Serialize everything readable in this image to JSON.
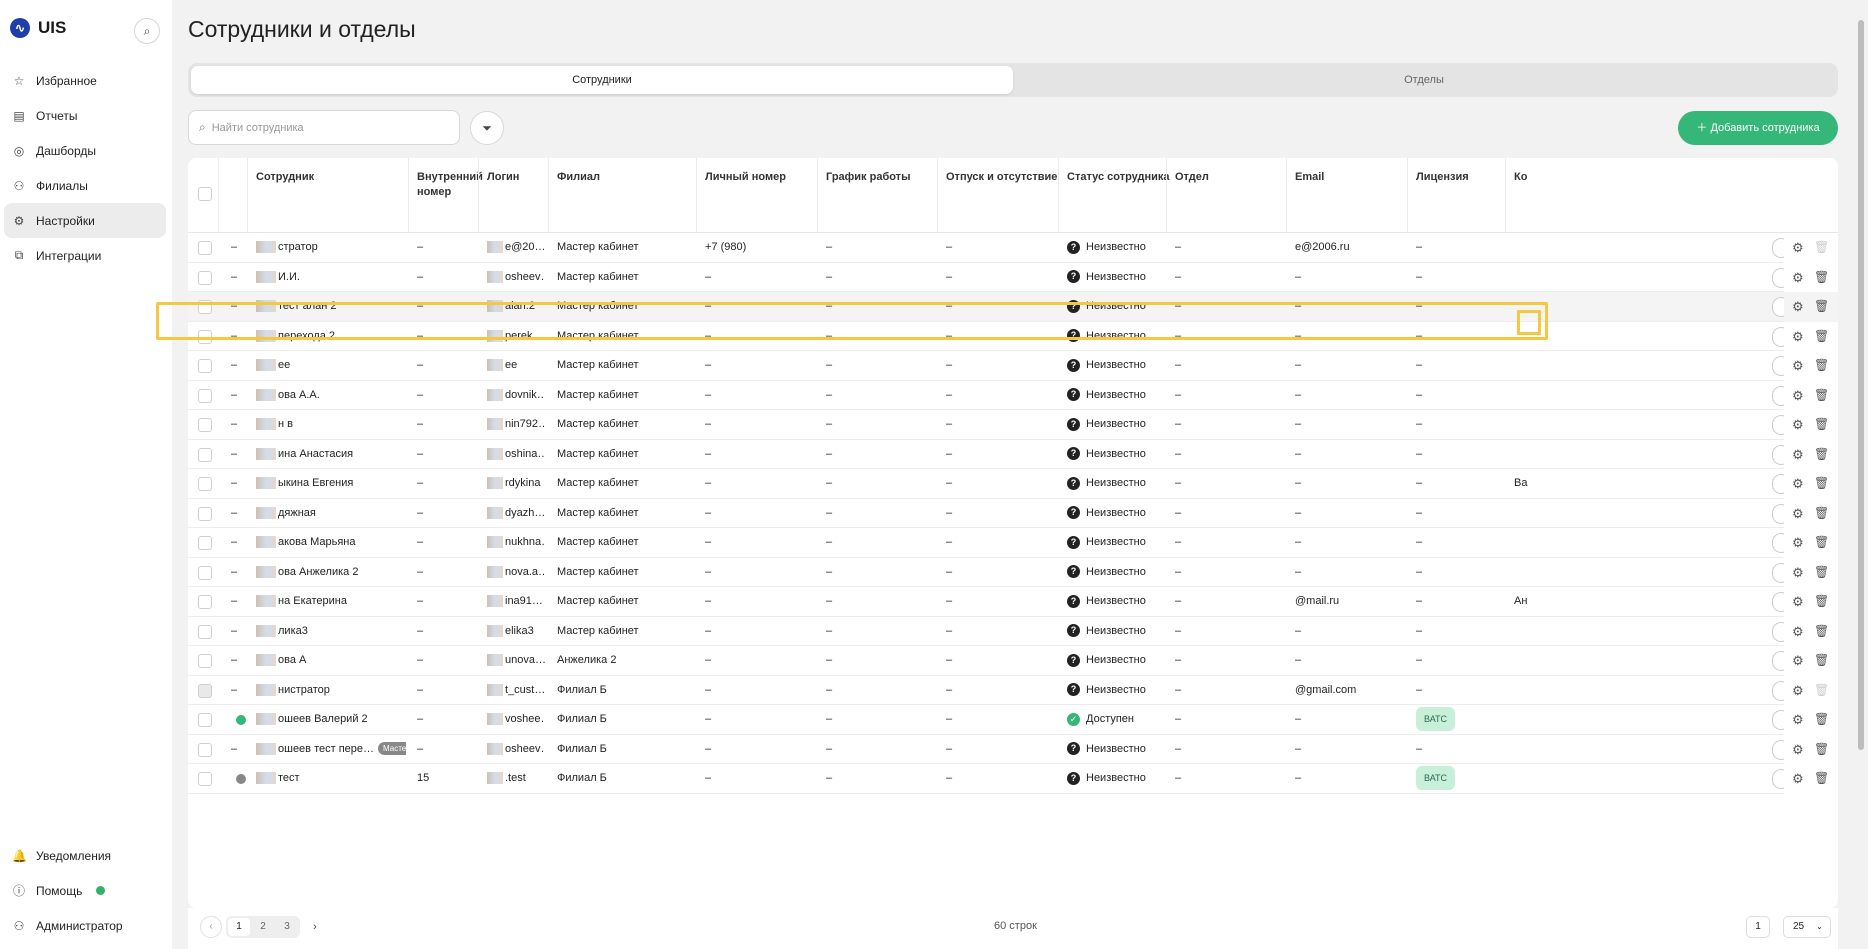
{
  "app": {
    "name": "UIS"
  },
  "sidebar": {
    "items": [
      {
        "label": "Избранное",
        "icon": "star-icon"
      },
      {
        "label": "Отчеты",
        "icon": "report-icon"
      },
      {
        "label": "Дашборды",
        "icon": "dashboard-icon"
      },
      {
        "label": "Филиалы",
        "icon": "branches-icon"
      },
      {
        "label": "Настройки",
        "icon": "gear-icon",
        "active": true
      },
      {
        "label": "Интеграции",
        "icon": "integrations-icon"
      }
    ],
    "bottom": [
      {
        "label": "Уведомления",
        "icon": "bell-icon"
      },
      {
        "label": "Помощь",
        "icon": "help-icon"
      },
      {
        "label": "Администратор",
        "icon": "user-icon"
      }
    ]
  },
  "page": {
    "title": "Сотрудники и отделы"
  },
  "tabs": [
    {
      "label": "Сотрудники",
      "active": true
    },
    {
      "label": "Отделы",
      "active": false
    }
  ],
  "search": {
    "placeholder": "Найти сотрудника"
  },
  "add_button": "Добавить сотрудника",
  "columns": {
    "employee": "Сотрудник",
    "ext": "Внутренний номер",
    "login": "Логин",
    "branch": "Филиал",
    "phone": "Личный номер",
    "schedule": "График работы",
    "vacation": "Отпуск и отсутствие",
    "status": "Статус сотрудника",
    "dept": "Отдел",
    "email": "Email",
    "license": "Лицензия",
    "ko": "Ко"
  },
  "rows": [
    {
      "dot": "–",
      "name": "стратор",
      "ext": "–",
      "login": "e@20…",
      "branch": "Мастер кабинет",
      "phone": "+7 (980)",
      "schedule": "–",
      "vacation": "–",
      "status": "Неизвестно",
      "dept": "–",
      "email": "e@2006.ru",
      "license": "–",
      "ko": "",
      "trash_disabled": true
    },
    {
      "dot": "–",
      "name": "И.И.",
      "ext": "–",
      "login": "osheev…",
      "branch": "Мастер кабинет",
      "phone": "–",
      "schedule": "–",
      "vacation": "–",
      "status": "Неизвестно",
      "dept": "–",
      "email": "–",
      "license": "–",
      "ko": ""
    },
    {
      "dot": "–",
      "name": "тест алан 2",
      "ext": "–",
      "login": "alan.2",
      "branch": "Мастер кабинет",
      "phone": "–",
      "schedule": "–",
      "vacation": "–",
      "status": "Неизвестно",
      "dept": "–",
      "email": "–",
      "license": "–",
      "ko": "",
      "highlight": true
    },
    {
      "dot": "–",
      "name": "перехода 2",
      "ext": "–",
      "login": "perek…",
      "branch": "Мастер кабинет",
      "phone": "–",
      "schedule": "–",
      "vacation": "–",
      "status": "Неизвестно",
      "dept": "–",
      "email": "–",
      "license": "–",
      "ko": ""
    },
    {
      "dot": "–",
      "name": "ee",
      "ext": "–",
      "login": "ee",
      "branch": "Мастер кабинет",
      "phone": "–",
      "schedule": "–",
      "vacation": "–",
      "status": "Неизвестно",
      "dept": "–",
      "email": "–",
      "license": "–",
      "ko": ""
    },
    {
      "dot": "–",
      "name": "ова А.А.",
      "ext": "–",
      "login": "dovnik…",
      "branch": "Мастер кабинет",
      "phone": "–",
      "schedule": "–",
      "vacation": "–",
      "status": "Неизвестно",
      "dept": "–",
      "email": "–",
      "license": "–",
      "ko": ""
    },
    {
      "dot": "–",
      "name": "н в",
      "ext": "–",
      "login": "nin792…",
      "branch": "Мастер кабинет",
      "phone": "–",
      "schedule": "–",
      "vacation": "–",
      "status": "Неизвестно",
      "dept": "–",
      "email": "–",
      "license": "–",
      "ko": ""
    },
    {
      "dot": "–",
      "name": "ина Анастасия",
      "ext": "–",
      "login": "oshina…",
      "branch": "Мастер кабинет",
      "phone": "–",
      "schedule": "–",
      "vacation": "–",
      "status": "Неизвестно",
      "dept": "–",
      "email": "–",
      "license": "–",
      "ko": ""
    },
    {
      "dot": "–",
      "name": "ыкина Евгения",
      "ext": "–",
      "login": "rdykina",
      "branch": "Мастер кабинет",
      "phone": "–",
      "schedule": "–",
      "vacation": "–",
      "status": "Неизвестно",
      "dept": "–",
      "email": "–",
      "license": "–",
      "ko": "Ва"
    },
    {
      "dot": "–",
      "name": "дяжная",
      "ext": "–",
      "login": "dyazh…",
      "branch": "Мастер кабинет",
      "phone": "–",
      "schedule": "–",
      "vacation": "–",
      "status": "Неизвестно",
      "dept": "–",
      "email": "–",
      "license": "–",
      "ko": ""
    },
    {
      "dot": "–",
      "name": "акова Марьяна",
      "ext": "–",
      "login": "nukhna…",
      "branch": "Мастер кабинет",
      "phone": "–",
      "schedule": "–",
      "vacation": "–",
      "status": "Неизвестно",
      "dept": "–",
      "email": "–",
      "license": "–",
      "ko": ""
    },
    {
      "dot": "–",
      "name": "ова Анжелика 2",
      "ext": "–",
      "login": "nova.a…",
      "branch": "Мастер кабинет",
      "phone": "–",
      "schedule": "–",
      "vacation": "–",
      "status": "Неизвестно",
      "dept": "–",
      "email": "–",
      "license": "–",
      "ko": ""
    },
    {
      "dot": "–",
      "name": "на Екатерина",
      "ext": "–",
      "login": "ina91…",
      "branch": "Мастер кабинет",
      "phone": "–",
      "schedule": "–",
      "vacation": "–",
      "status": "Неизвестно",
      "dept": "–",
      "email": "@mail.ru",
      "license": "–",
      "ko": "Ан"
    },
    {
      "dot": "–",
      "name": "лика3",
      "ext": "–",
      "login": "elika3",
      "branch": "Мастер кабинет",
      "phone": "–",
      "schedule": "–",
      "vacation": "–",
      "status": "Неизвестно",
      "dept": "–",
      "email": "–",
      "license": "–",
      "ko": ""
    },
    {
      "dot": "–",
      "name": "ова А",
      "ext": "–",
      "login": "unova…",
      "branch": "Анжелика 2",
      "phone": "–",
      "schedule": "–",
      "vacation": "–",
      "status": "Неизвестно",
      "dept": "–",
      "email": "–",
      "license": "–",
      "ko": ""
    },
    {
      "dot": "–",
      "name": "нистратор",
      "ext": "–",
      "login": "t_cust…",
      "branch": "Филиал Б",
      "phone": "–",
      "schedule": "–",
      "vacation": "–",
      "status": "Неизвестно",
      "dept": "–",
      "email": "@gmail.com",
      "license": "–",
      "ko": "",
      "checkbox_disabled": true,
      "trash_disabled": true
    },
    {
      "dot": "green",
      "name": "ошеев Валерий 2",
      "ext": "–",
      "login": "vosheе…",
      "branch": "Филиал Б",
      "phone": "–",
      "schedule": "–",
      "vacation": "–",
      "status": "Доступен",
      "status_ok": true,
      "dept": "–",
      "email": "–",
      "license": "ВАТС",
      "ko": ""
    },
    {
      "dot": "–",
      "name": "ошеев тест пере…",
      "tag": "Мастер",
      "ext": "–",
      "login": "osheev…",
      "branch": "Филиал Б",
      "phone": "–",
      "schedule": "–",
      "vacation": "–",
      "status": "Неизвестно",
      "dept": "–",
      "email": "–",
      "license": "–",
      "ko": ""
    },
    {
      "dot": "gray",
      "name": "тест",
      "ext": "15",
      "login": ".test",
      "branch": "Филиал Б",
      "phone": "–",
      "schedule": "–",
      "vacation": "–",
      "status": "Неизвестно",
      "dept": "–",
      "email": "–",
      "license": "ВАТС",
      "ko": ""
    }
  ],
  "footer": {
    "pages": [
      "1",
      "2",
      "3"
    ],
    "rows_count": "60 строк",
    "page_input": "1",
    "per_page": "25"
  },
  "colors": {
    "accent": "#35b779",
    "highlight": "#f5c842",
    "brand": "#1e3fa8"
  }
}
